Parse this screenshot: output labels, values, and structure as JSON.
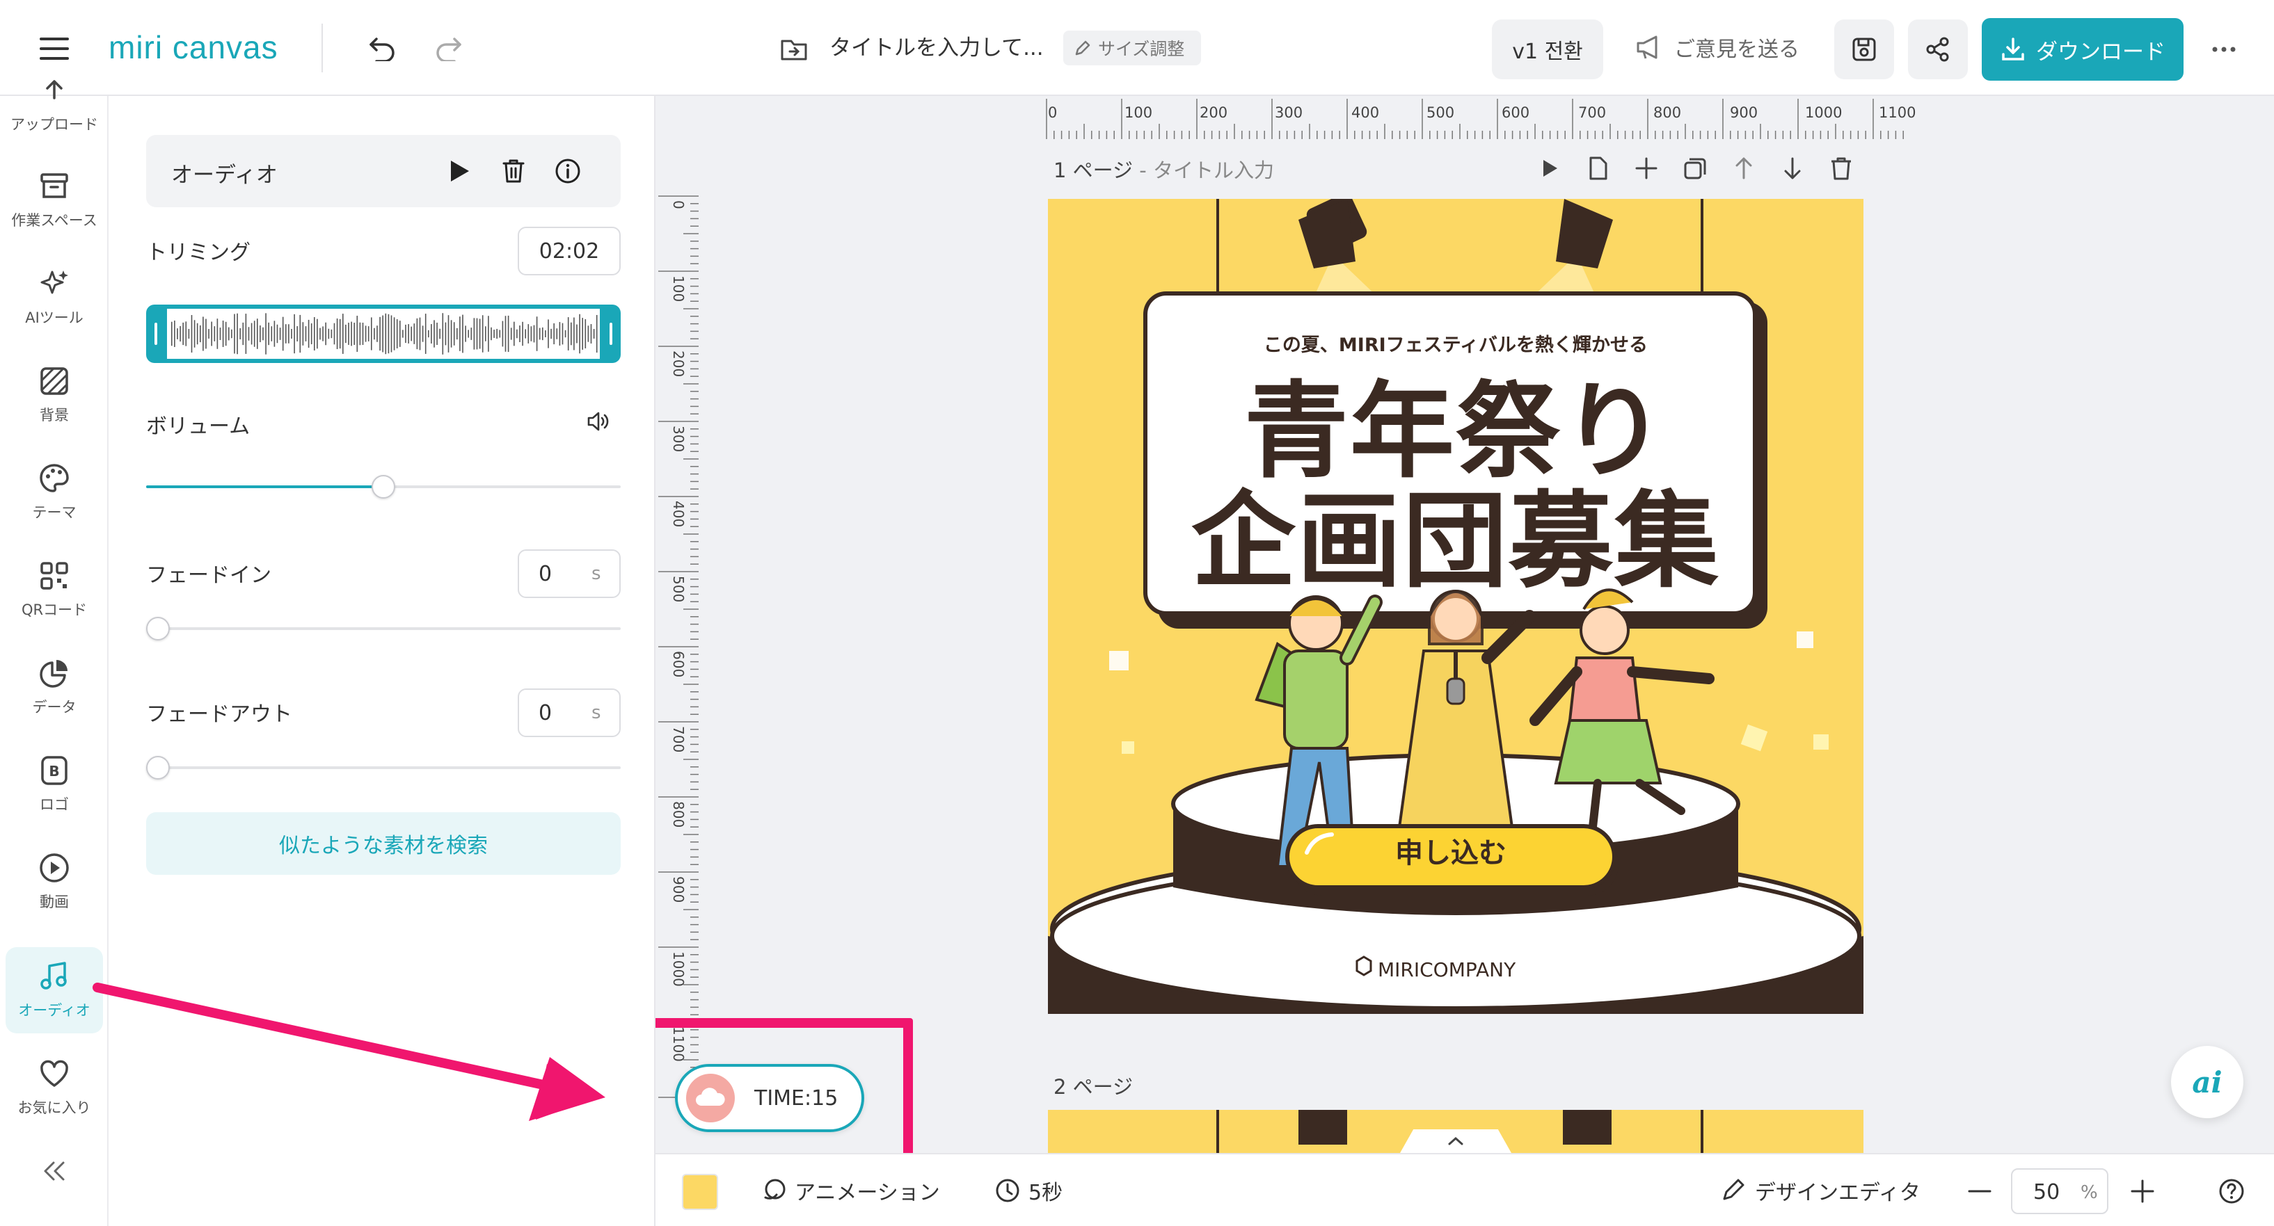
{
  "header": {
    "logo": "miri canvas",
    "doc_title": "タイトルを入力して...",
    "resize_label": "サイズ調整",
    "version_label": "v1 전환",
    "feedback_label": "ご意見を送る",
    "download_label": "ダウンロード"
  },
  "rail": {
    "items": [
      {
        "label": "アップロード",
        "icon": "upload-icon"
      },
      {
        "label": "作業スペース",
        "icon": "archive-icon"
      },
      {
        "label": "AIツール",
        "icon": "sparkle-icon"
      },
      {
        "label": "背景",
        "icon": "background-icon"
      },
      {
        "label": "テーマ",
        "icon": "palette-icon"
      },
      {
        "label": "QRコード",
        "icon": "qr-icon"
      },
      {
        "label": "データ",
        "icon": "chart-icon"
      },
      {
        "label": "ロゴ",
        "icon": "logo-icon"
      },
      {
        "label": "動画",
        "icon": "play-circle-icon"
      },
      {
        "label": "オーディオ",
        "icon": "music-icon"
      },
      {
        "label": "お気に入り",
        "icon": "heart-icon"
      }
    ],
    "active": "オーディオ"
  },
  "panel": {
    "audio_title": "オーディオ",
    "trimming_label": "トリミング",
    "trimming_value": "02:02",
    "volume_label": "ボリューム",
    "volume_level": 0.5,
    "fadein_label": "フェードイン",
    "fadein_value": "0",
    "fadein_unit": "s",
    "fadeout_label": "フェードアウト",
    "fadeout_value": "0",
    "fadeout_unit": "s",
    "similar_button": "似たような素材を検索"
  },
  "canvas": {
    "ruler_h": [
      "0",
      "100",
      "200",
      "300",
      "400",
      "500",
      "600",
      "700",
      "800",
      "900",
      "1000",
      "1100"
    ],
    "ruler_v": [
      "0",
      "100",
      "200",
      "300",
      "400",
      "500",
      "600",
      "700",
      "800",
      "900",
      "1000",
      "1100"
    ],
    "page1_label": "1 ページ",
    "page1_sub": " - タイトル入力",
    "page2_label": "2 ページ",
    "poster": {
      "subtitle": "この夏、MIRIフェスティバルを熱く輝かせる",
      "title_line1": "青年祭り",
      "title_line2": "企画団募集",
      "cta": "申し込む",
      "company": "MIRICOMPANY",
      "bg_color": "#fcd864"
    },
    "time_badge": "TIME:15"
  },
  "bottom": {
    "animation_label": "アニメーション",
    "duration_label": "5秒",
    "design_editor_label": "デザインエディタ",
    "zoom_value": "50",
    "zoom_unit": "%"
  },
  "colors": {
    "accent": "#1aa7b8",
    "highlight": "#f0166e",
    "poster_dark": "#3b2a22"
  }
}
